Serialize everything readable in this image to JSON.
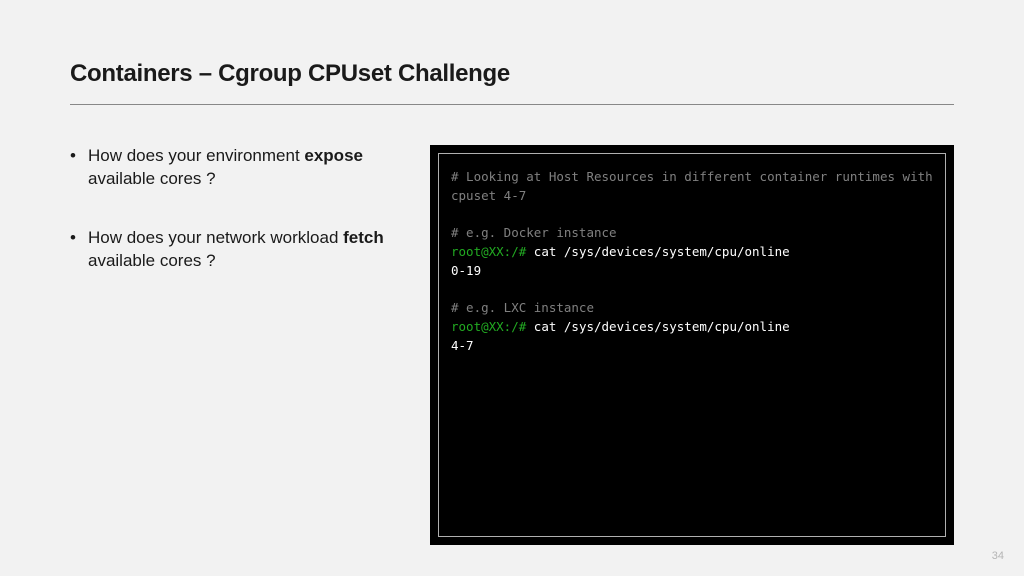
{
  "title": "Containers – Cgroup CPUset Challenge",
  "bullets": [
    {
      "pre": "How does your environment ",
      "bold": "expose",
      "post": " available cores ?"
    },
    {
      "pre": "How does your network workload ",
      "bold": "fetch",
      "post": " available cores ?"
    }
  ],
  "terminal": {
    "lines": [
      {
        "cls": "comment",
        "text": "# Looking at Host Resources in different container runtimes with cpuset 4-7"
      },
      {
        "cls": "blank",
        "text": ""
      },
      {
        "cls": "comment",
        "text": "# e.g. Docker instance"
      },
      {
        "cls": "cmdline",
        "prompt": "root@XX:/#",
        "cmd": " cat /sys/devices/system/cpu/online"
      },
      {
        "cls": "out",
        "text": "0-19"
      },
      {
        "cls": "blank",
        "text": ""
      },
      {
        "cls": "comment",
        "text": "# e.g. LXC instance"
      },
      {
        "cls": "cmdline",
        "prompt": "root@XX:/#",
        "cmd": " cat /sys/devices/system/cpu/online"
      },
      {
        "cls": "out",
        "text": "4-7"
      }
    ]
  },
  "page_number": "34"
}
